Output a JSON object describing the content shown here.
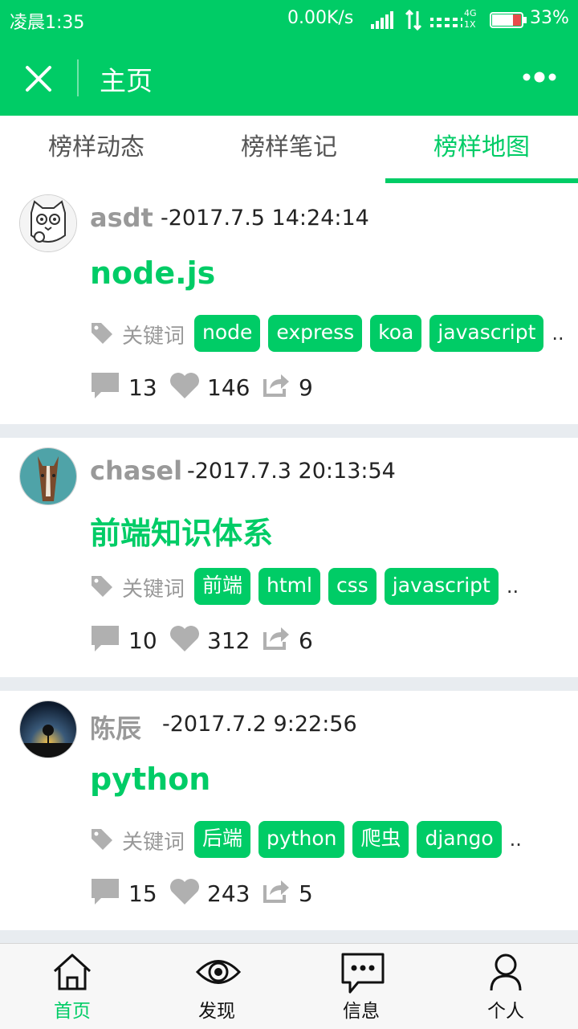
{
  "status_bar": {
    "time": "凌晨1:35",
    "speed": "0.00K/s",
    "network": "4G 1X",
    "battery": "33%"
  },
  "header": {
    "title": "主页",
    "close_icon": "close-icon",
    "more_icon": "more-dots-icon"
  },
  "tabs": [
    {
      "label": "榜样动态",
      "active": false
    },
    {
      "label": "榜样笔记",
      "active": false
    },
    {
      "label": "榜样地图",
      "active": true
    }
  ],
  "keyword_label": "关键词",
  "posts": [
    {
      "author": "asdt",
      "datetime": "-2017.7.5 14:24:14",
      "title": "node.js",
      "tags": [
        "node",
        "express",
        "koa",
        "javascript"
      ],
      "tags_more": "..",
      "comments": "13",
      "likes": "146",
      "shares": "9"
    },
    {
      "author": "chasel",
      "datetime": "-2017.7.3 20:13:54",
      "title": "前端知识体系",
      "tags": [
        "前端",
        "html",
        "css",
        "javascript"
      ],
      "tags_more": "..",
      "comments": "10",
      "likes": "312",
      "shares": "6"
    },
    {
      "author": "陈辰",
      "datetime": "-2017.7.2 9:22:56",
      "title": "python",
      "tags": [
        "后端",
        "python",
        "爬虫",
        "django"
      ],
      "tags_more": "..",
      "comments": "15",
      "likes": "243",
      "shares": "5"
    }
  ],
  "bottom_nav": [
    {
      "label": "首页",
      "icon": "home-icon",
      "active": true
    },
    {
      "label": "发现",
      "icon": "eye-icon",
      "active": false
    },
    {
      "label": "信息",
      "icon": "message-icon",
      "active": false
    },
    {
      "label": "个人",
      "icon": "person-icon",
      "active": false
    }
  ],
  "colors": {
    "brand": "#00cc66",
    "muted": "#999999",
    "separator": "#e8ecf0"
  }
}
